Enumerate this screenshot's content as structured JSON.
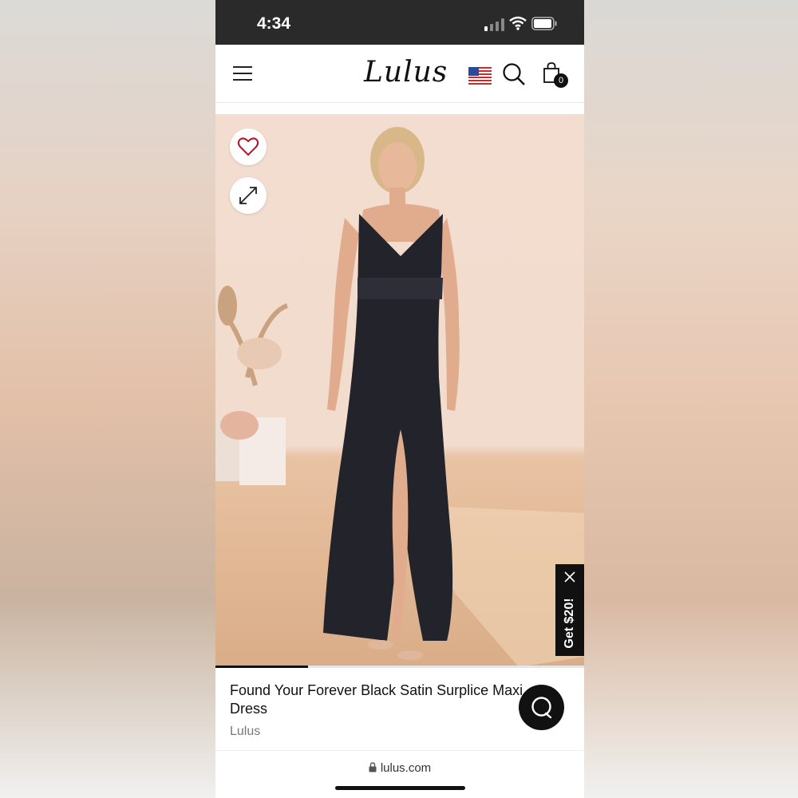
{
  "status_bar": {
    "time": "4:34"
  },
  "header": {
    "logo": "Lulus",
    "cart_count": "0"
  },
  "promo": {
    "label": "Get $20!"
  },
  "product": {
    "title": "Found Your Forever Black Satin Surplice Maxi Dress",
    "brand": "Lulus",
    "image_index": 1,
    "image_progress": 0.25
  },
  "browser": {
    "url": "lulus.com"
  },
  "icons": [
    "menu-icon",
    "flag-icon",
    "search-icon",
    "bag-icon",
    "heart-icon",
    "expand-icon",
    "close-icon",
    "chat-icon",
    "lock-icon",
    "signal-icon",
    "wifi-icon",
    "battery-icon"
  ],
  "colors": {
    "accent": "#b3162c",
    "dark": "#111111"
  }
}
